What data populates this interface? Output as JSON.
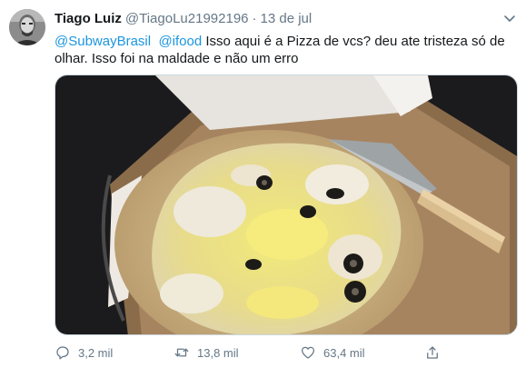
{
  "tweet": {
    "author_name": "Tiago Luiz",
    "author_handle": "@TiagoLu21992196",
    "separator": "·",
    "time": "13 de jul",
    "mention_1": "@SubwayBrasil",
    "mention_2": "@ifood",
    "text_line1": " Isso aqui é a Pizza de vcs? deu ate tristeza só de olhar. Isso foi na maldade e não um erro"
  },
  "icons": {
    "avatar": "user-avatar",
    "caret": "chevron-down-icon",
    "reply": "reply-icon",
    "retweet": "retweet-icon",
    "like": "heart-icon",
    "share": "share-icon"
  },
  "stats": {
    "replies": "3,2 mil",
    "retweets": "13,8 mil",
    "likes": "63,4 mil"
  },
  "colors": {
    "link": "#1b95e0",
    "secondary_text": "#657786",
    "primary_text": "#14171a"
  }
}
